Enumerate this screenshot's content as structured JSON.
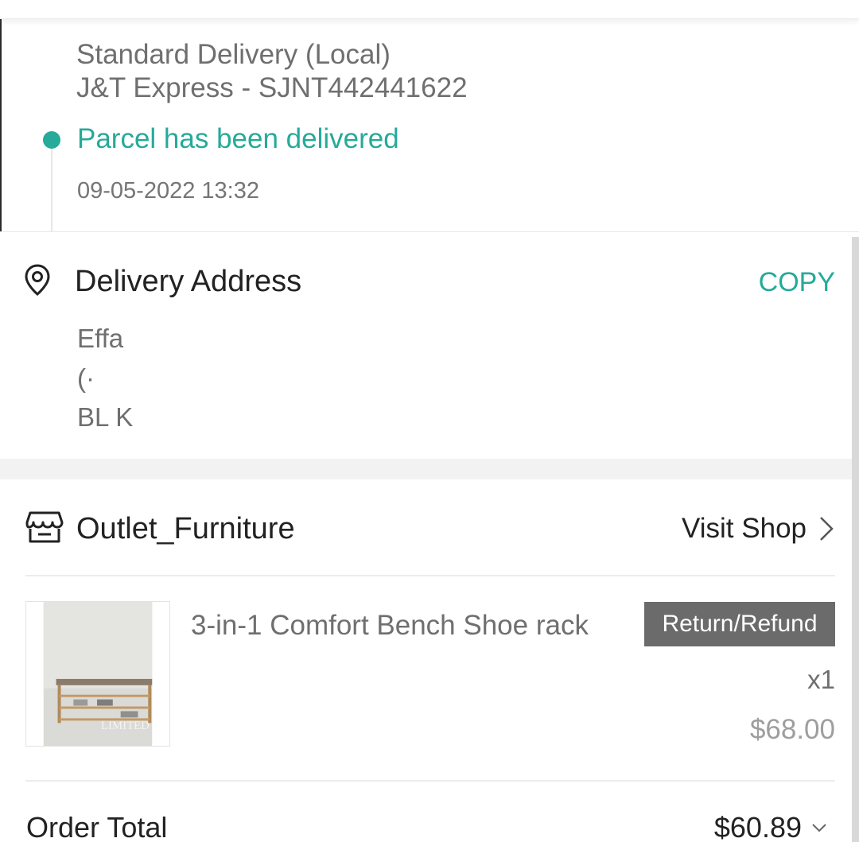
{
  "shipping": {
    "method": "Standard Delivery (Local)",
    "carrier": "J&T Express - SJNT442441622",
    "status": "Parcel has been delivered",
    "status_time": "09-05-2022 13:32"
  },
  "address": {
    "title": "Delivery Address",
    "copy_label": "COPY",
    "name": "Effa",
    "phone": "(·",
    "street": "BL    K"
  },
  "shop": {
    "name": "Outlet_Furniture",
    "visit_label": "Visit Shop"
  },
  "product": {
    "title": "3-in-1 Comfort Bench Shoe rack",
    "refund_label": "Return/Refund",
    "quantity": "x1",
    "price": "$68.00",
    "image_watermark": "LIMITED"
  },
  "order": {
    "total_label": "Order Total",
    "total_value": "$60.89"
  },
  "colors": {
    "accent": "#26aa99",
    "refund_button": "#6b6b6b"
  }
}
